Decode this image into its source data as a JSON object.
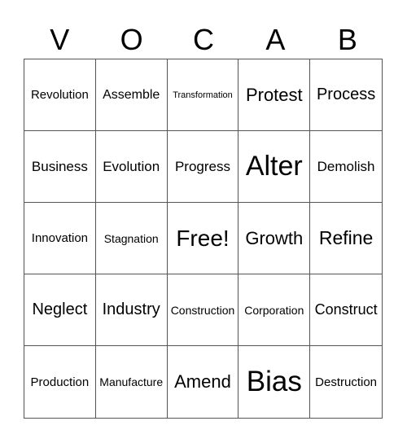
{
  "header": [
    "V",
    "O",
    "C",
    "A",
    "B"
  ],
  "rows": [
    [
      "Revolution",
      "Assemble",
      "Transformation",
      "Protest",
      "Process"
    ],
    [
      "Business",
      "Evolution",
      "Progress",
      "Alter",
      "Demolish"
    ],
    [
      "Innovation",
      "Stagnation",
      "Free!",
      "Growth",
      "Refine"
    ],
    [
      "Neglect",
      "Industry",
      "Construction",
      "Corporation",
      "Construct"
    ],
    [
      "Production",
      "Manufacture",
      "Amend",
      "Bias",
      "Destruction"
    ]
  ]
}
